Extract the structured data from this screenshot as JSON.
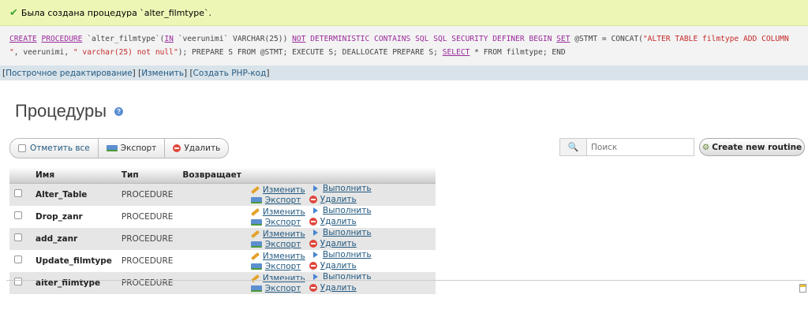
{
  "message": {
    "text": "Была создана процедура `alter_filmtype`."
  },
  "sql": {
    "p1": "CREATE",
    "p2": "PROCEDURE",
    "p3": " `alter_filmtype`(",
    "p4": "IN",
    "p5": " `veerunimi` VARCHAR(25)) ",
    "p6": "NOT",
    "p7": " DETERMINISTIC CONTAINS SQL SQL SECURITY DEFINER BEGIN ",
    "p8": "SET",
    "p9": " @STMT = CONCAT(",
    "p10": "\"ALTER TABLE filmtype ADD COLUMN \"",
    "p11": ", veerunimi, ",
    "p12": "\" varchar(25) not null\"",
    "p13": "); PREPARE S FROM @STMT; EXECUTE S; DEALLOCATE PREPARE S; ",
    "p14": "SELECT",
    "p15": " * FROM filmtype; END"
  },
  "sql_links": {
    "inline_edit": "Построчное редактирование",
    "edit": "Изменить",
    "create_php": "Создать PHP-код"
  },
  "page": {
    "title": "Процедуры"
  },
  "toolbar": {
    "check_all": "Отметить все",
    "export": "Экспорт",
    "delete": "Удалить"
  },
  "search": {
    "placeholder": "Поиск"
  },
  "create_routine": "Create new routine",
  "table": {
    "headers": {
      "name": "Имя",
      "type": "Тип",
      "returns": "Возвращает"
    },
    "actions": {
      "edit": "Изменить",
      "execute": "Выполнить",
      "export": "Экспорт",
      "delete": "Удалить"
    },
    "rows": [
      {
        "name": "Alter_Table",
        "type": "PROCEDURE",
        "returns": ""
      },
      {
        "name": "Drop_zanr",
        "type": "PROCEDURE",
        "returns": ""
      },
      {
        "name": "add_zanr",
        "type": "PROCEDURE",
        "returns": ""
      },
      {
        "name": "Update_filmtype",
        "type": "PROCEDURE",
        "returns": ""
      },
      {
        "name": "alter_filmtype",
        "type": "PROCEDURE",
        "returns": ""
      }
    ]
  },
  "colors": {
    "success_bg": "#eef6b6",
    "link": "#235a81",
    "keyword": "#9a2b9a",
    "string": "#c52b2b"
  }
}
